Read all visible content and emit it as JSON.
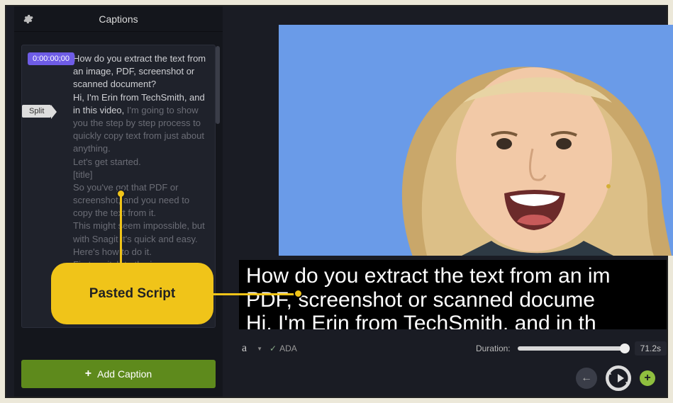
{
  "panel": {
    "title": "Captions",
    "timestamp": "0:00:00;00",
    "split_label": "Split",
    "caption_active": "How do you extract the text from an image, PDF, screenshot or scanned document?\nHi, I'm Erin from TechSmith, and in this video,",
    "caption_dim": " I'm going to show you the step by step process to quickly copy text from just about anything.\nLet's get started.\n[title]\nSo you've got that PDF or screenshot, and you need to copy the text from it.\nThis might seem impossible, but with Snagit it's quick and easy.\nHere's how to do it.\nFirst, switch to the image",
    "add_caption_label": "Add Caption"
  },
  "preview": {
    "caption_overlay": "How do you extract the text from an im\nPDF, screenshot or scanned docume\nHi, I'm Erin from TechSmith, and in th"
  },
  "controls": {
    "font_sample": "a",
    "ada_label": "ADA",
    "duration_label": "Duration:",
    "duration_value": "71.2s"
  },
  "annotation": {
    "label": "Pasted Script"
  },
  "icons": {
    "gear": "gear-icon",
    "plus": "plus-icon",
    "check": "check-icon",
    "chevron_down": "chevron-down-icon",
    "arrow_left": "arrow-left-icon",
    "loop": "loop-play-icon",
    "add_small": "plus-small-icon"
  }
}
